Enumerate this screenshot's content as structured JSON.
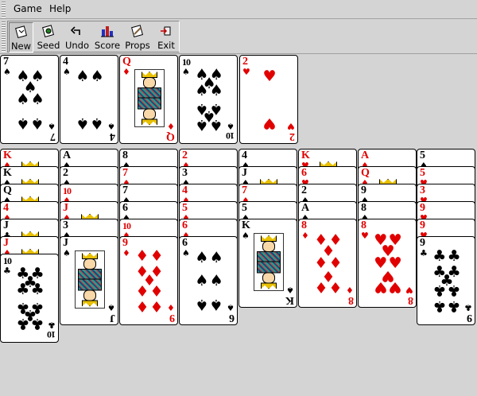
{
  "menu": {
    "items": [
      "Game",
      "Help"
    ]
  },
  "toolbar": {
    "buttons": [
      {
        "label": "New",
        "icon": "new-game-icon"
      },
      {
        "label": "Seed",
        "icon": "seed-icon"
      },
      {
        "label": "Undo",
        "icon": "undo-icon"
      },
      {
        "label": "Score",
        "icon": "score-icon"
      },
      {
        "label": "Props",
        "icon": "props-icon"
      },
      {
        "label": "Exit",
        "icon": "exit-icon"
      }
    ]
  },
  "colors": {
    "background": "#d4d4d4",
    "red_suit": "#e00000",
    "black_suit": "#000000",
    "card": "#ffffff"
  },
  "free_cells": [
    {
      "rank": "7",
      "suit": "♠"
    },
    {
      "rank": "4",
      "suit": "♠"
    },
    {
      "rank": "Q",
      "suit": "♦"
    },
    {
      "rank": "10",
      "suit": "♠"
    }
  ],
  "foundations": [
    {
      "rank": "2",
      "suit": "♥"
    }
  ],
  "tableau": [
    [
      {
        "rank": "K",
        "suit": "♦"
      },
      {
        "rank": "K",
        "suit": "♠"
      },
      {
        "rank": "Q",
        "suit": "♠"
      },
      {
        "rank": "4",
        "suit": "♦"
      },
      {
        "rank": "J",
        "suit": "♣"
      },
      {
        "rank": "J",
        "suit": "♦"
      },
      {
        "rank": "10",
        "suit": "♣"
      }
    ],
    [
      {
        "rank": "A",
        "suit": "♠"
      },
      {
        "rank": "2",
        "suit": "♠"
      },
      {
        "rank": "10",
        "suit": "♦"
      },
      {
        "rank": "J",
        "suit": "♦"
      },
      {
        "rank": "3",
        "suit": "♠"
      },
      {
        "rank": "J",
        "suit": "♠"
      }
    ],
    [
      {
        "rank": "8",
        "suit": "♠"
      },
      {
        "rank": "7",
        "suit": "♦"
      },
      {
        "rank": "7",
        "suit": "♠"
      },
      {
        "rank": "6",
        "suit": "♠"
      },
      {
        "rank": "10",
        "suit": "♦"
      },
      {
        "rank": "9",
        "suit": "♦"
      }
    ],
    [
      {
        "rank": "2",
        "suit": "♦"
      },
      {
        "rank": "3",
        "suit": "♠"
      },
      {
        "rank": "4",
        "suit": "♦"
      },
      {
        "rank": "5",
        "suit": "♦"
      },
      {
        "rank": "6",
        "suit": "♦"
      },
      {
        "rank": "6",
        "suit": "♠"
      }
    ],
    [
      {
        "rank": "4",
        "suit": "♠"
      },
      {
        "rank": "J",
        "suit": "♠"
      },
      {
        "rank": "7",
        "suit": "♦"
      },
      {
        "rank": "5",
        "suit": "♠"
      },
      {
        "rank": "K",
        "suit": "♠"
      }
    ],
    [
      {
        "rank": "K",
        "suit": "♥"
      },
      {
        "rank": "6",
        "suit": "♥"
      },
      {
        "rank": "2",
        "suit": "♠"
      },
      {
        "rank": "A",
        "suit": "♠"
      },
      {
        "rank": "8",
        "suit": "♦"
      }
    ],
    [
      {
        "rank": "A",
        "suit": "♦"
      },
      {
        "rank": "Q",
        "suit": "♦"
      },
      {
        "rank": "9",
        "suit": "♠"
      },
      {
        "rank": "8",
        "suit": "♠"
      },
      {
        "rank": "8",
        "suit": "♥"
      }
    ],
    [
      {
        "rank": "5",
        "suit": "♠"
      },
      {
        "rank": "5",
        "suit": "♥"
      },
      {
        "rank": "3",
        "suit": "♥"
      },
      {
        "rank": "9",
        "suit": "♥"
      },
      {
        "rank": "9",
        "suit": "♥"
      },
      {
        "rank": "9",
        "suit": "♣"
      }
    ]
  ]
}
